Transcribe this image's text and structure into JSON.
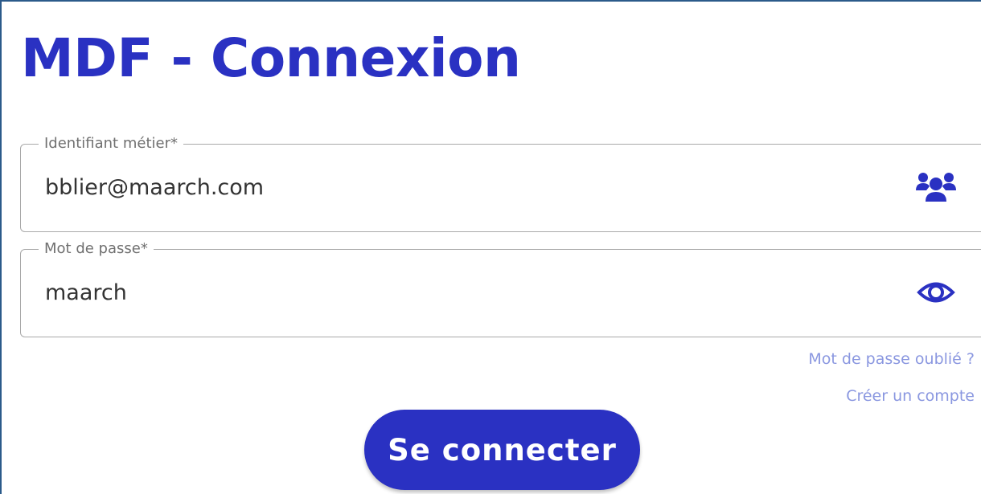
{
  "page": {
    "title": "MDF - Connexion"
  },
  "login_field": {
    "label": "Identifiant métier*",
    "value": "bblier@maarch.com",
    "icon": "users-icon"
  },
  "password_field": {
    "label": "Mot de passe*",
    "value": "maarch",
    "icon": "eye-icon"
  },
  "links": {
    "forgot_password": "Mot de passe oublié ?",
    "create_account": "Créer un compte"
  },
  "connect_button": {
    "label": "Se connecter"
  },
  "colors": {
    "accent": "#2a31c2",
    "link": "#8a97e0",
    "field_border": "#a9a9a9",
    "label": "#707070"
  }
}
